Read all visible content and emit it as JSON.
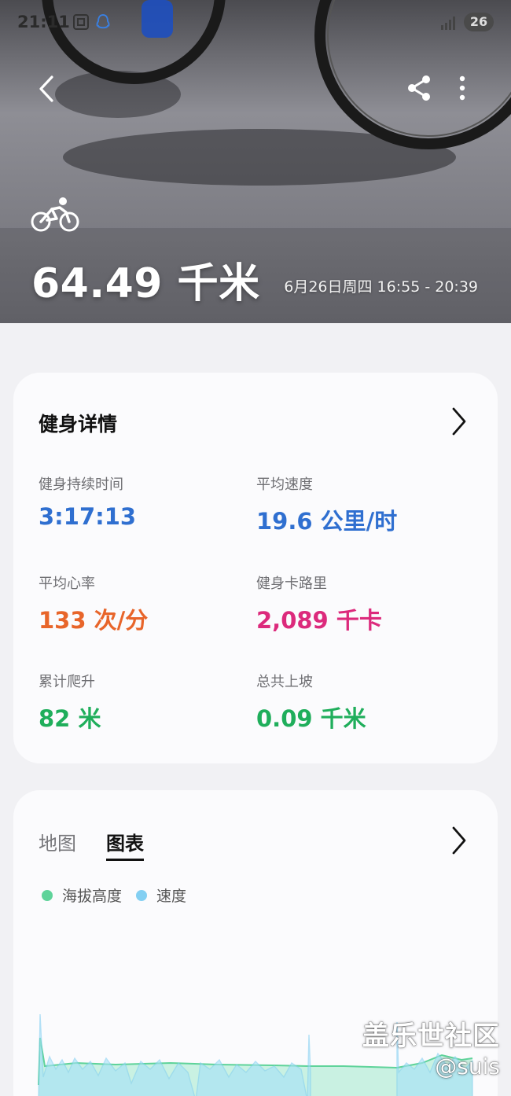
{
  "status_bar": {
    "time": "21:11",
    "battery": "26"
  },
  "hero": {
    "activity_icon": "bicycle-icon",
    "distance": "64.49 千米",
    "datetime": "6月26日周四 16:55 - 20:39"
  },
  "details_card": {
    "title": "健身详情",
    "metrics": [
      {
        "label": "健身持续时间",
        "value": "3:17:13",
        "color": "#2f6fd0"
      },
      {
        "label": "平均速度",
        "value": "19.6 公里/时",
        "color": "#2f6fd0"
      },
      {
        "label": "平均心率",
        "value": "133 次/分",
        "color": "#e8652a"
      },
      {
        "label": "健身卡路里",
        "value": "2,089 千卡",
        "color": "#dc2a7c"
      },
      {
        "label": "累计爬升",
        "value": "82 米",
        "color": "#1fae5b"
      },
      {
        "label": "总共上坡",
        "value": "0.09 千米",
        "color": "#1fae5b"
      }
    ]
  },
  "chart_card": {
    "tabs": [
      "地图",
      "图表"
    ],
    "active_tab": "图表",
    "legend": [
      {
        "name": "海拔高度",
        "color": "#5fd39a"
      },
      {
        "name": "速度",
        "color": "#83cff2"
      }
    ]
  },
  "watermark": {
    "site": "盖乐世社区",
    "user": "@suis"
  }
}
